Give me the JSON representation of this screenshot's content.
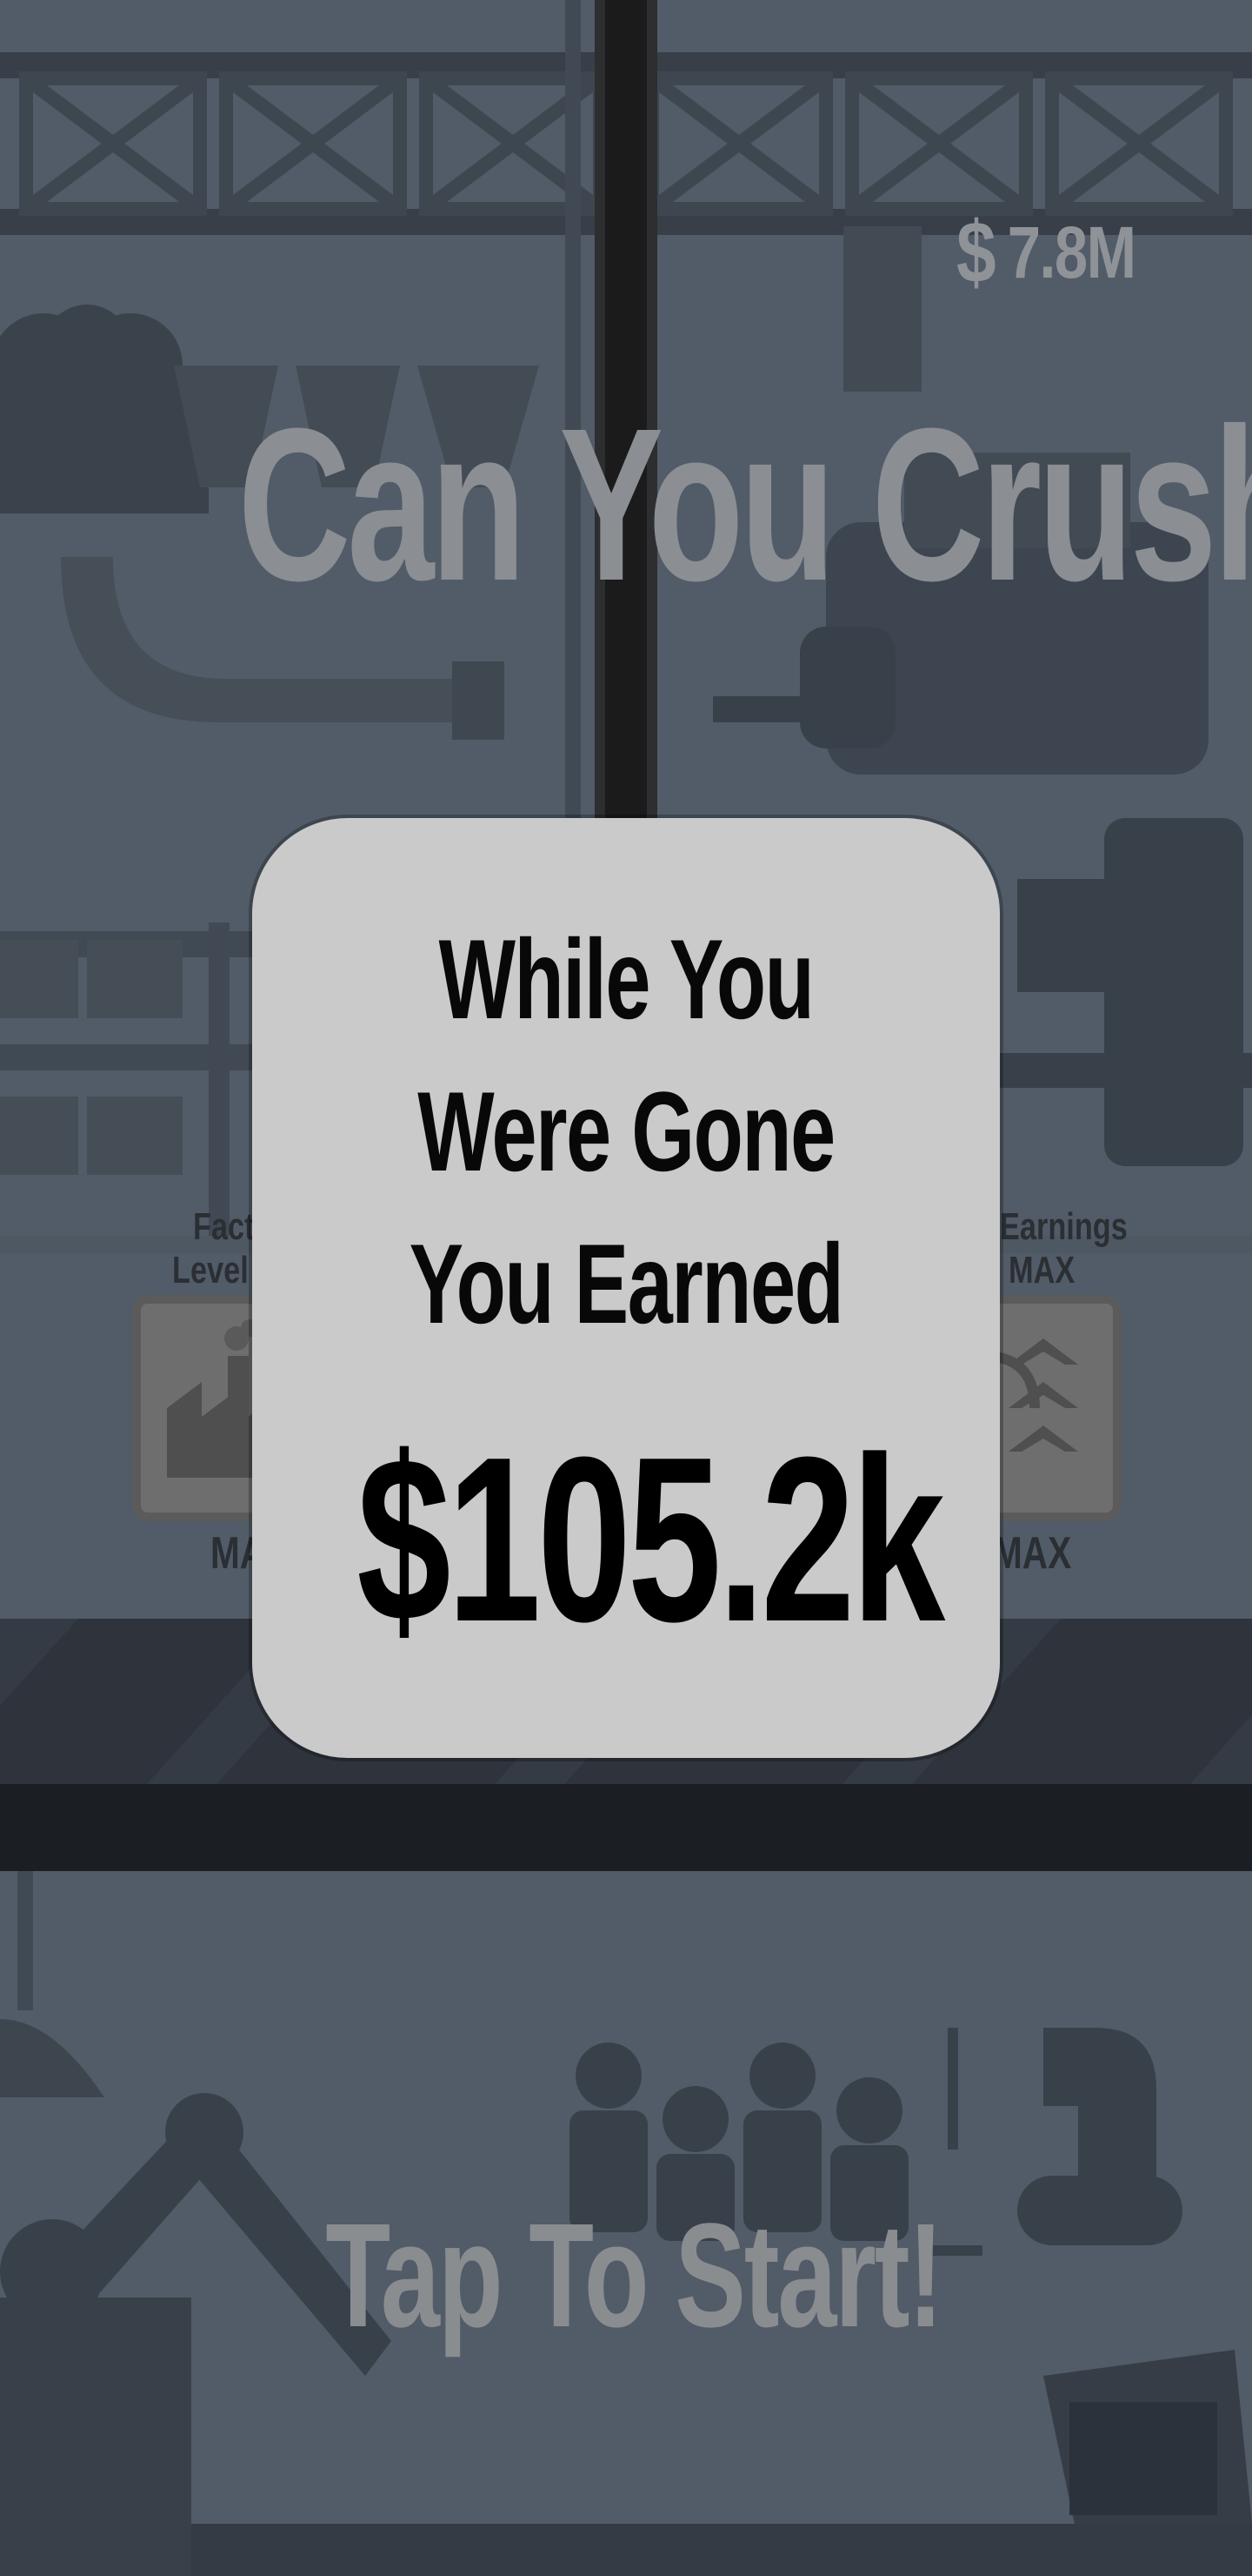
{
  "hud": {
    "money_symbol": "$",
    "money_value": "7.8M"
  },
  "title": "Can You Crush",
  "stats": {
    "left_label_line1": "Factory",
    "left_label_line2": "Level",
    "left_bottom": "MAX",
    "right_label_line1": "Earnings",
    "right_label_line2": "MAX",
    "right_bottom": "MAX"
  },
  "popup": {
    "line1": "While You",
    "line2": "Were Gone",
    "line3": "You Earned",
    "amount": "$105.2k"
  },
  "cta": "Tap To Start!",
  "colors": {
    "background": "#5d6a78",
    "overlay_dim": "#4d5663",
    "popup_bg": "#cacaca",
    "title_text": "#8b8e93"
  },
  "icons": {
    "factory": "factory-icon",
    "earnings": "earnings-upgrade-icon"
  }
}
